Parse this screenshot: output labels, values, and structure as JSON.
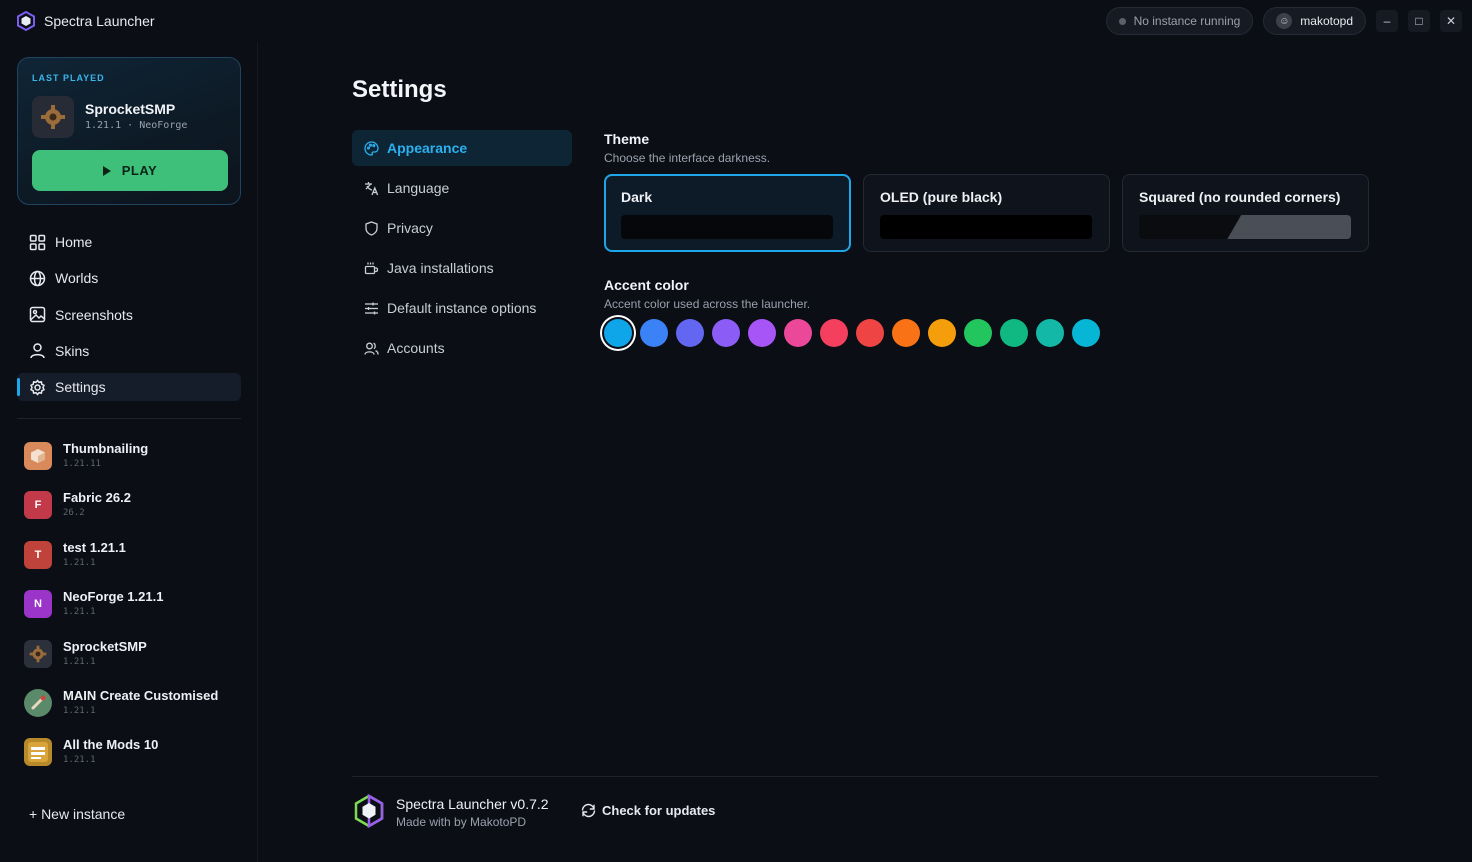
{
  "app": {
    "title": "Spectra Launcher"
  },
  "titlebar": {
    "status": "No instance running",
    "user": "makotopd",
    "minimize": "–",
    "maximize": "□",
    "close": "✕"
  },
  "last_played": {
    "label": "LAST PLAYED",
    "name": "SprocketSMP",
    "version": "1.21.1",
    "separator": "·",
    "loader": "NeoForge",
    "play_label": "PLAY"
  },
  "nav": [
    {
      "label": "Home",
      "icon": "grid-icon"
    },
    {
      "label": "Worlds",
      "icon": "globe-icon"
    },
    {
      "label": "Screenshots",
      "icon": "image-icon"
    },
    {
      "label": "Skins",
      "icon": "user-icon"
    },
    {
      "label": "Settings",
      "icon": "gear-icon",
      "active": true
    }
  ],
  "instances": [
    {
      "name": "Thumbnailing",
      "version": "1.21.11",
      "letter": "",
      "color": "#d9895a"
    },
    {
      "name": "Fabric 26.2",
      "version": "26.2",
      "letter": "F",
      "color": "#c2394a"
    },
    {
      "name": "test 1.21.1",
      "version": "1.21.1",
      "letter": "T",
      "color": "#c0433b"
    },
    {
      "name": "NeoForge 1.21.1",
      "version": "1.21.1",
      "letter": "N",
      "color": "#9b35c9"
    },
    {
      "name": "SprocketSMP",
      "version": "1.21.1",
      "letter": "",
      "color": "#2b303a"
    },
    {
      "name": "MAIN Create Customised",
      "version": "1.21.1",
      "letter": "",
      "color": "#5a8a6a"
    },
    {
      "name": "All the Mods 10",
      "version": "1.21.1",
      "letter": "",
      "color": "#b8892a"
    }
  ],
  "new_instance": "+ New instance",
  "settings": {
    "title": "Settings",
    "subnav": [
      {
        "label": "Appearance",
        "icon": "palette-icon",
        "active": true
      },
      {
        "label": "Language",
        "icon": "translate-icon"
      },
      {
        "label": "Privacy",
        "icon": "shield-icon"
      },
      {
        "label": "Java installations",
        "icon": "coffee-icon"
      },
      {
        "label": "Default instance options",
        "icon": "sliders-icon"
      },
      {
        "label": "Accounts",
        "icon": "users-icon"
      }
    ],
    "theme": {
      "title": "Theme",
      "description": "Choose the interface darkness.",
      "options": [
        {
          "label": "Dark",
          "selected": true
        },
        {
          "label": "OLED (pure black)"
        },
        {
          "label": "Squared (no rounded corners)"
        }
      ]
    },
    "accent": {
      "title": "Accent color",
      "description": "Accent color used across the launcher.",
      "colors": [
        "#0ea5e9",
        "#3b82f6",
        "#6366f1",
        "#8b5cf6",
        "#a855f7",
        "#ec4899",
        "#f43f5e",
        "#ef4444",
        "#f97316",
        "#f59e0b",
        "#22c55e",
        "#10b981",
        "#14b8a6",
        "#06b6d4"
      ],
      "selected_index": 0
    }
  },
  "footer": {
    "name": "Spectra Launcher v0.7.2",
    "credit": "Made with by MakotoPD",
    "check_updates": "Check for updates"
  }
}
